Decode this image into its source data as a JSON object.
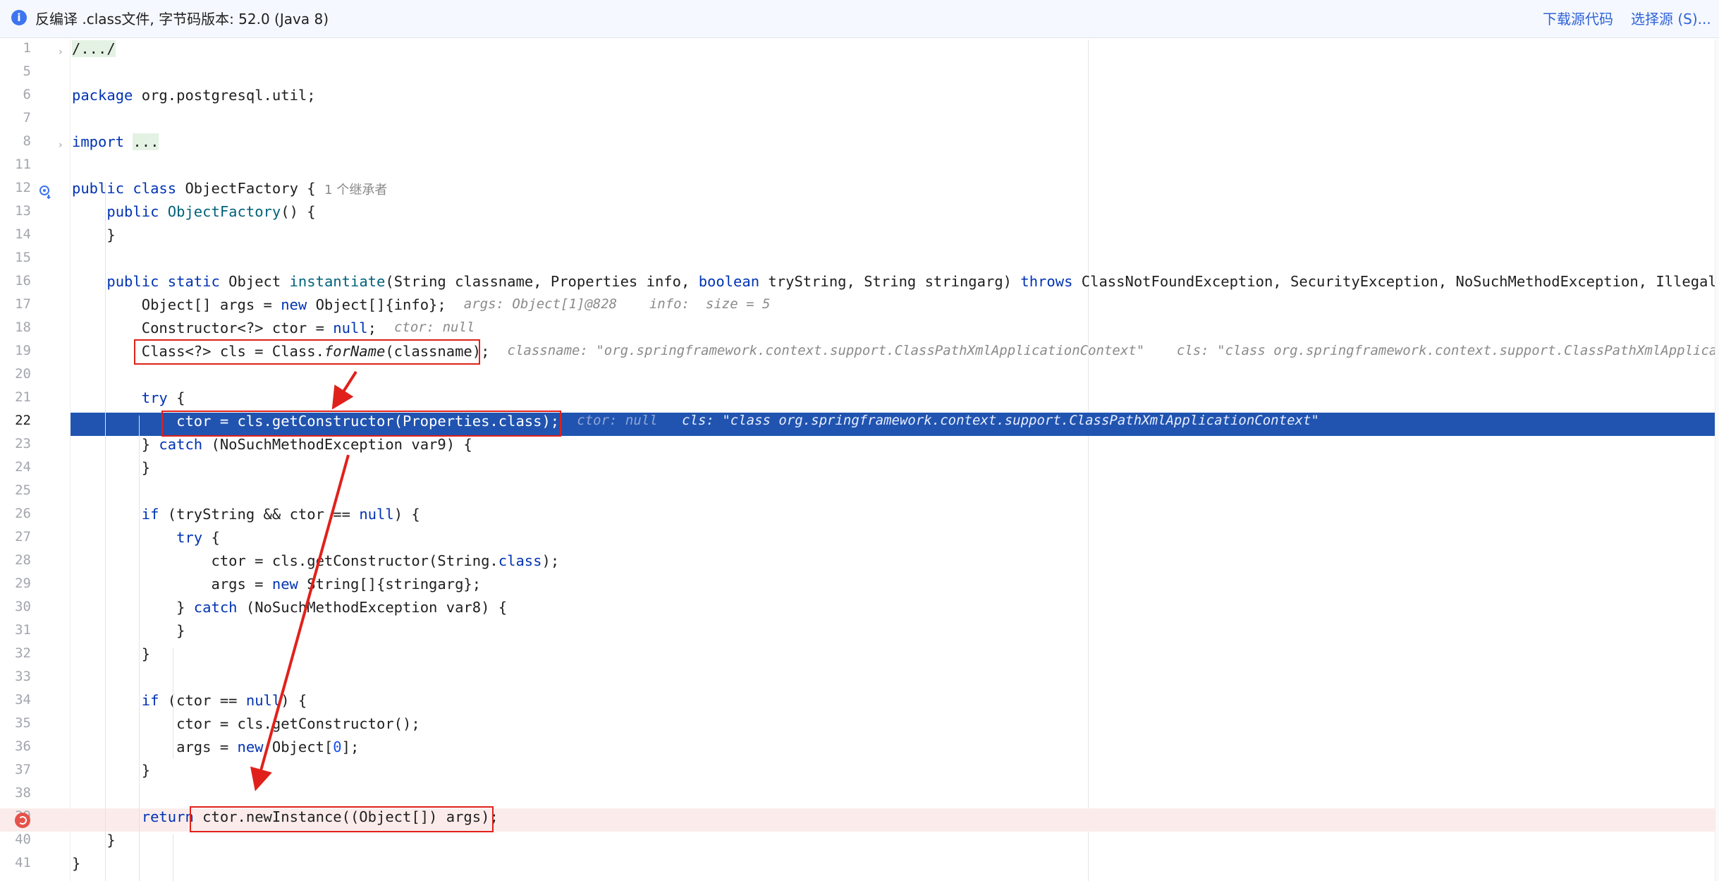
{
  "banner": {
    "icon": "info-icon",
    "message": "反编译 .class文件, 字节码版本: 52.0 (Java 8)",
    "download_source": "下载源代码",
    "choose_source": "选择源 (S)..."
  },
  "inheritors_hint": "1 个继承者",
  "lines": [
    {
      "n": "1",
      "tokens": [
        {
          "t": "/.../",
          "c": "fold-mark"
        }
      ],
      "fold": true
    },
    {
      "n": "5",
      "tokens": []
    },
    {
      "n": "6",
      "tokens": [
        {
          "t": "package",
          "c": "kw"
        },
        {
          "t": " org.postgresql.util;"
        }
      ]
    },
    {
      "n": "7",
      "tokens": []
    },
    {
      "n": "8",
      "tokens": [
        {
          "t": "import",
          "c": "kw"
        },
        {
          "t": " "
        },
        {
          "t": "...",
          "c": "fold-mark"
        }
      ],
      "fold": true
    },
    {
      "n": "11",
      "tokens": []
    },
    {
      "n": "12",
      "tokens": [
        {
          "t": "public",
          "c": "kw"
        },
        {
          "t": " "
        },
        {
          "t": "class",
          "c": "kw"
        },
        {
          "t": " ObjectFactory {"
        }
      ],
      "impl_icon": true,
      "note": "1 个继承者"
    },
    {
      "n": "13",
      "tokens": [
        {
          "t": "    "
        },
        {
          "t": "public",
          "c": "kw"
        },
        {
          "t": " "
        },
        {
          "t": "ObjectFactory",
          "c": "fn"
        },
        {
          "t": "() {"
        }
      ]
    },
    {
      "n": "14",
      "tokens": [
        {
          "t": "    }"
        }
      ]
    },
    {
      "n": "15",
      "tokens": []
    },
    {
      "n": "16",
      "tokens": [
        {
          "t": "    "
        },
        {
          "t": "public",
          "c": "kw"
        },
        {
          "t": " "
        },
        {
          "t": "static",
          "c": "kw"
        },
        {
          "t": " Object "
        },
        {
          "t": "instantiate",
          "c": "fn"
        },
        {
          "t": "(String classname, Properties info, "
        },
        {
          "t": "boolean",
          "c": "kw"
        },
        {
          "t": " tryString, String stringarg) "
        },
        {
          "t": "throws",
          "c": "kw"
        },
        {
          "t": " ClassNotFoundException, SecurityException, NoSuchMethodException, IllegalArgumentException"
        }
      ]
    },
    {
      "n": "17",
      "tokens": [
        {
          "t": "        Object[] args = "
        },
        {
          "t": "new",
          "c": "kw"
        },
        {
          "t": " Object[]{info};"
        }
      ],
      "hints": [
        {
          "t": "args: Object[1]@828    info:  size = 5"
        }
      ]
    },
    {
      "n": "18",
      "tokens": [
        {
          "t": "        Constructor<?> ctor = "
        },
        {
          "t": "null",
          "c": "kw"
        },
        {
          "t": ";"
        }
      ],
      "hints": [
        {
          "t": "ctor: null"
        }
      ]
    },
    {
      "n": "19",
      "tokens": [
        {
          "t": "        Class<?> cls = Class."
        },
        {
          "t": "forName",
          "c": "it"
        },
        {
          "t": "(classname);"
        }
      ],
      "hints": [
        {
          "t": "classname: \"org.springframework.context.support.ClassPathXmlApplicationContext\"    cls: \"class org.springframework.context.support.ClassPathXmlApplicationContext\""
        }
      ]
    },
    {
      "n": "20",
      "tokens": []
    },
    {
      "n": "21",
      "tokens": [
        {
          "t": "        "
        },
        {
          "t": "try",
          "c": "kw"
        },
        {
          "t": " {"
        }
      ]
    },
    {
      "n": "22",
      "tokens": [
        {
          "t": "            ctor = cls.getConstructor(Properties.class);"
        }
      ],
      "current": true,
      "hints": [
        {
          "t": "ctor: null",
          "dim": true
        },
        {
          "t": "cls: \"class org.springframework.context.support.ClassPathXmlApplicationContext\""
        }
      ]
    },
    {
      "n": "23",
      "tokens": [
        {
          "t": "        } "
        },
        {
          "t": "catch",
          "c": "kw"
        },
        {
          "t": " (NoSuchMethodException var9) {"
        }
      ]
    },
    {
      "n": "24",
      "tokens": [
        {
          "t": "        }"
        }
      ]
    },
    {
      "n": "25",
      "tokens": []
    },
    {
      "n": "26",
      "tokens": [
        {
          "t": "        "
        },
        {
          "t": "if",
          "c": "kw"
        },
        {
          "t": " (tryString && ctor == "
        },
        {
          "t": "null",
          "c": "kw"
        },
        {
          "t": ") {"
        }
      ]
    },
    {
      "n": "27",
      "tokens": [
        {
          "t": "            "
        },
        {
          "t": "try",
          "c": "kw"
        },
        {
          "t": " {"
        }
      ]
    },
    {
      "n": "28",
      "tokens": [
        {
          "t": "                ctor = cls.getConstructor(String."
        },
        {
          "t": "class",
          "c": "kw"
        },
        {
          "t": ");"
        }
      ]
    },
    {
      "n": "29",
      "tokens": [
        {
          "t": "                args = "
        },
        {
          "t": "new",
          "c": "kw"
        },
        {
          "t": " String[]{stringarg};"
        }
      ]
    },
    {
      "n": "30",
      "tokens": [
        {
          "t": "            } "
        },
        {
          "t": "catch",
          "c": "kw"
        },
        {
          "t": " (NoSuchMethodException var8) {"
        }
      ]
    },
    {
      "n": "31",
      "tokens": [
        {
          "t": "            }"
        }
      ]
    },
    {
      "n": "32",
      "tokens": [
        {
          "t": "        }"
        }
      ]
    },
    {
      "n": "33",
      "tokens": []
    },
    {
      "n": "34",
      "tokens": [
        {
          "t": "        "
        },
        {
          "t": "if",
          "c": "kw"
        },
        {
          "t": " (ctor == "
        },
        {
          "t": "null",
          "c": "kw"
        },
        {
          "t": ") {"
        }
      ]
    },
    {
      "n": "35",
      "tokens": [
        {
          "t": "            ctor = cls.getConstructor();"
        }
      ]
    },
    {
      "n": "36",
      "tokens": [
        {
          "t": "            args = "
        },
        {
          "t": "new",
          "c": "kw"
        },
        {
          "t": " Object["
        },
        {
          "t": "0",
          "c": "num"
        },
        {
          "t": "];"
        }
      ]
    },
    {
      "n": "37",
      "tokens": [
        {
          "t": "        }"
        }
      ]
    },
    {
      "n": "38",
      "tokens": []
    },
    {
      "n": "39",
      "tokens": [
        {
          "t": "        "
        },
        {
          "t": "return",
          "c": "kw"
        },
        {
          "t": " ctor.newInstance((Object[]) args);"
        }
      ],
      "breakpoint": true
    },
    {
      "n": "40",
      "tokens": [
        {
          "t": "    }"
        }
      ]
    },
    {
      "n": "41",
      "tokens": [
        {
          "t": "}"
        }
      ]
    }
  ],
  "colors": {
    "keyword": "#0033b3",
    "current_line": "#2154b0",
    "breakpoint_line": "#fbeceb",
    "annotation_red": "#e0211b"
  }
}
